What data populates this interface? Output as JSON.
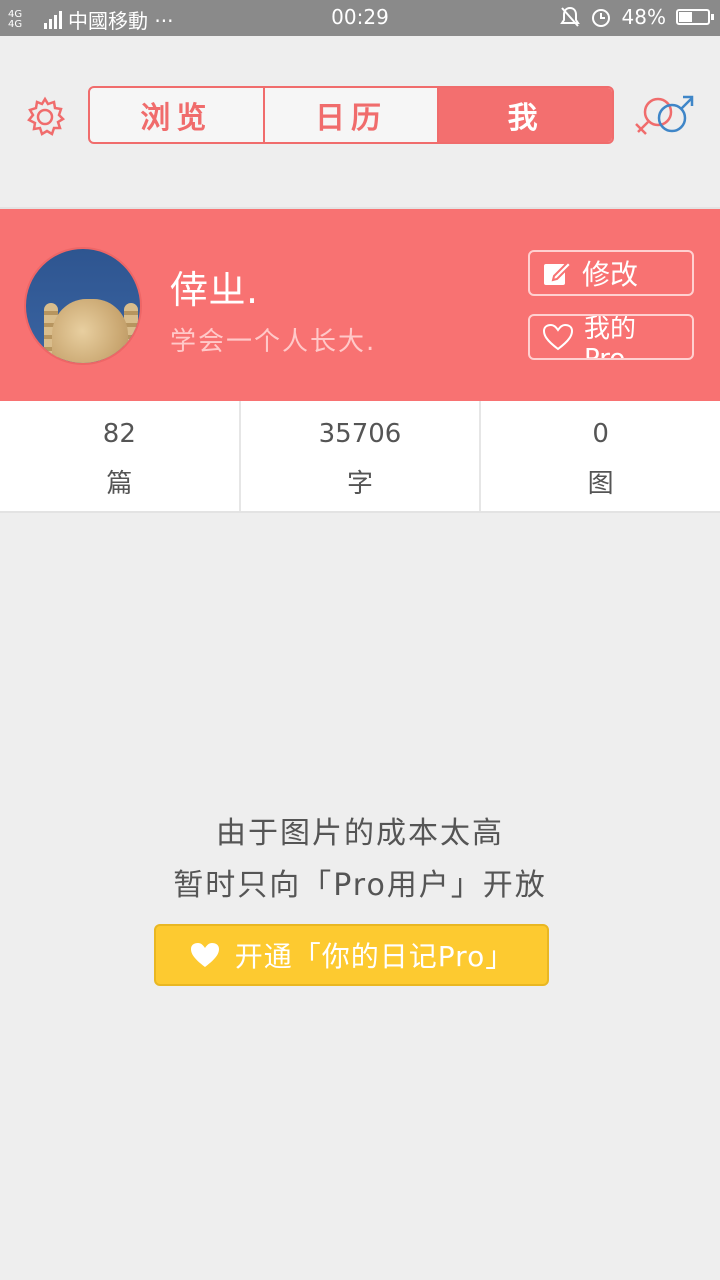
{
  "status_bar": {
    "network": "4G 4G",
    "carrier": "中國移動 ···",
    "time": "00:29",
    "battery": "48%",
    "battery_level": 0.48
  },
  "nav": {
    "tabs": [
      {
        "label": "浏览",
        "active": false
      },
      {
        "label": "日历",
        "active": false
      },
      {
        "label": "我",
        "active": true
      }
    ]
  },
  "profile": {
    "username": "倖ㄓ.",
    "motto": "学会一个人长大.",
    "edit_label": "修改",
    "mypro_label": "我的Pro"
  },
  "stats": [
    {
      "value": "82",
      "unit": "篇"
    },
    {
      "value": "35706",
      "unit": "字"
    },
    {
      "value": "0",
      "unit": "图"
    }
  ],
  "notice": {
    "line1": "由于图片的成本太高",
    "line2": "暂时只向「Pro用户」开放",
    "button_label": "开通「你的日记Pro」"
  },
  "colors": {
    "accent": "#f87272",
    "pro_yellow": "#fdca30",
    "background": "#eeeeee"
  }
}
